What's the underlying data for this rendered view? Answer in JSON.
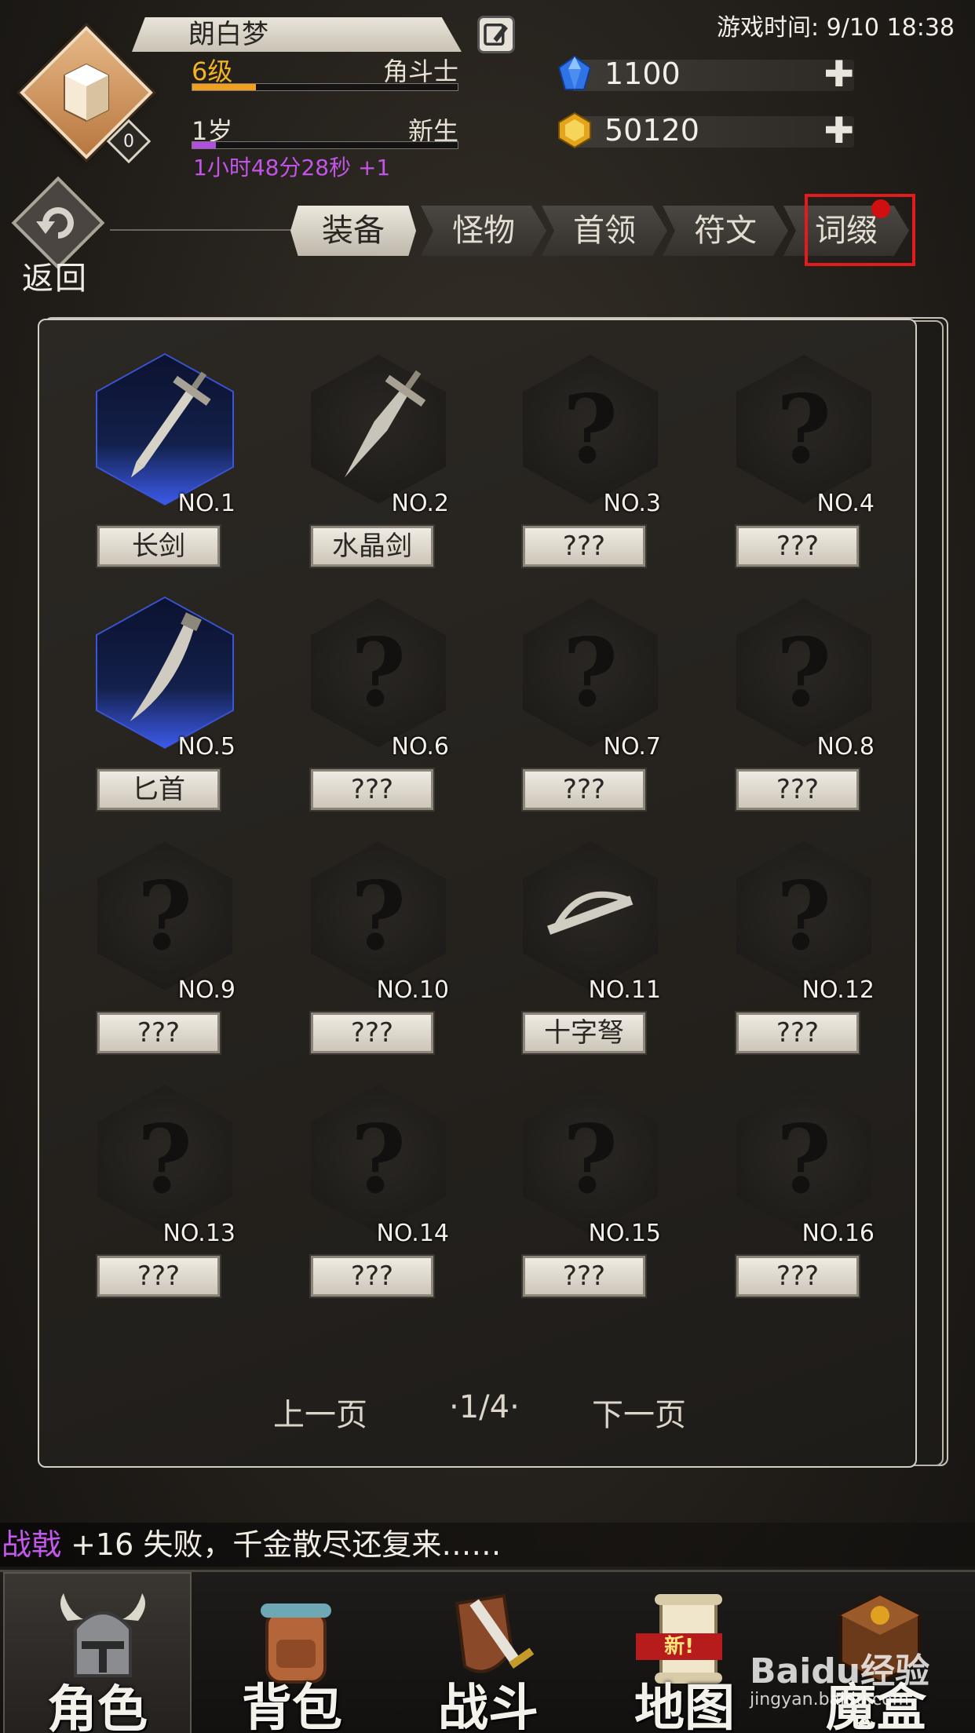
{
  "header": {
    "player_name": "朗白梦",
    "avatar_level": "0",
    "level": "6级",
    "class": "角斗士",
    "level_progress": 0.24,
    "age": "1岁",
    "age_stage": "新生",
    "age_progress": 0.09,
    "timer": "1小时48分28秒 +1",
    "game_time": "游戏时间: 9/10 18:38",
    "currencies": [
      {
        "icon": "blue-diamond-icon",
        "value": "1100",
        "color": "#3a7bea"
      },
      {
        "icon": "gold-gem-icon",
        "value": "50120",
        "color": "#e2a51c"
      }
    ]
  },
  "back_label": "返回",
  "tabs": [
    "装备",
    "怪物",
    "首领",
    "符文",
    "词缀"
  ],
  "active_tab": "装备",
  "items": [
    {
      "no": "NO.1",
      "name": "长剑",
      "owned": true,
      "art": "sword"
    },
    {
      "no": "NO.2",
      "name": "水晶剑",
      "owned": false,
      "art": "crystal-sword"
    },
    {
      "no": "NO.3",
      "name": "???",
      "owned": false,
      "art": "unknown"
    },
    {
      "no": "NO.4",
      "name": "???",
      "owned": false,
      "art": "unknown"
    },
    {
      "no": "NO.5",
      "name": "匕首",
      "owned": true,
      "art": "dagger"
    },
    {
      "no": "NO.6",
      "name": "???",
      "owned": false,
      "art": "unknown"
    },
    {
      "no": "NO.7",
      "name": "???",
      "owned": false,
      "art": "unknown"
    },
    {
      "no": "NO.8",
      "name": "???",
      "owned": false,
      "art": "unknown"
    },
    {
      "no": "NO.9",
      "name": "???",
      "owned": false,
      "art": "unknown"
    },
    {
      "no": "NO.10",
      "name": "???",
      "owned": false,
      "art": "unknown"
    },
    {
      "no": "NO.11",
      "name": "十字弩",
      "owned": false,
      "art": "crossbow"
    },
    {
      "no": "NO.12",
      "name": "???",
      "owned": false,
      "art": "unknown"
    },
    {
      "no": "NO.13",
      "name": "???",
      "owned": false,
      "art": "unknown"
    },
    {
      "no": "NO.14",
      "name": "???",
      "owned": false,
      "art": "unknown"
    },
    {
      "no": "NO.15",
      "name": "???",
      "owned": false,
      "art": "unknown"
    },
    {
      "no": "NO.16",
      "name": "???",
      "owned": false,
      "art": "unknown"
    }
  ],
  "pager": {
    "prev": "上一页",
    "page": "·1/4·",
    "next": "下一页"
  },
  "log": {
    "weapon": "战戟",
    "message": " +16 失败，千金散尽还复来……"
  },
  "nav": [
    {
      "label": "角色",
      "icon": "helmet-icon"
    },
    {
      "label": "背包",
      "icon": "backpack-icon"
    },
    {
      "label": "战斗",
      "icon": "sword-shield-icon"
    },
    {
      "label": "地图",
      "icon": "scroll-map-icon",
      "badge": "新!"
    },
    {
      "label": "魔盒",
      "icon": "magic-box-icon"
    }
  ],
  "watermark": {
    "brand": "Baidu经验",
    "url": "jingyan.baidu.com"
  },
  "colors": {
    "highlight": "#e21c1c",
    "owned_glow": "#3b55d8",
    "level_bar": "#f0a01e",
    "age_bar": "#b14ee0"
  }
}
